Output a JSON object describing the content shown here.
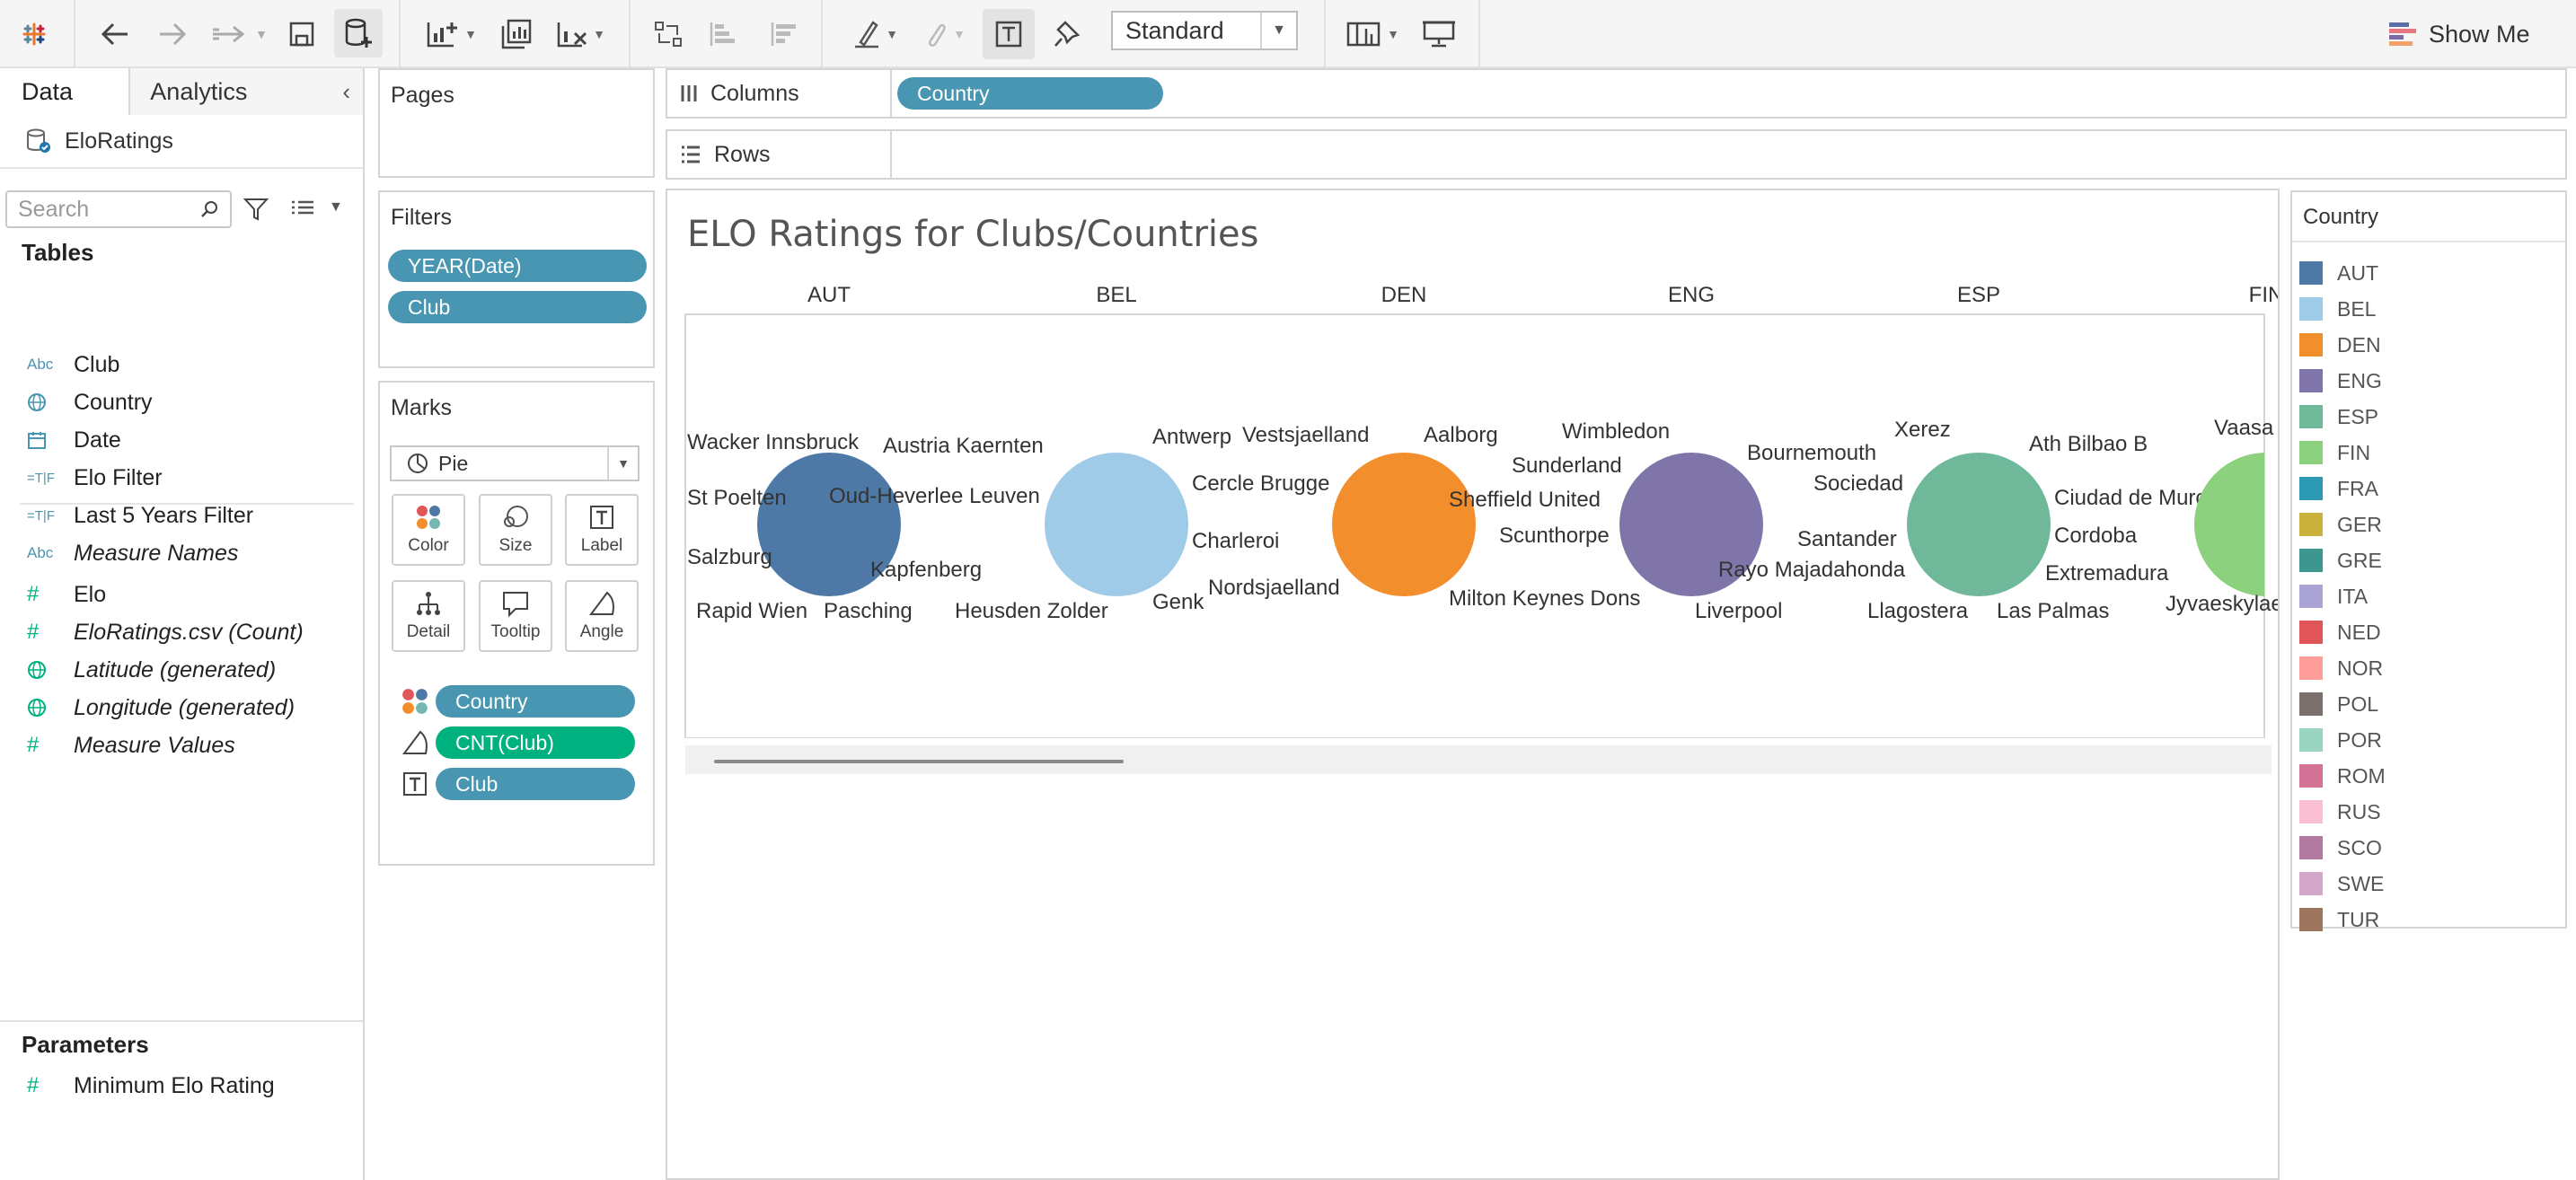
{
  "toolbar": {
    "mark_type_select": "Standard",
    "show_me": "Show Me"
  },
  "data_pane": {
    "tabs": [
      "Data",
      "Analytics"
    ],
    "datasource": "EloRatings",
    "search_placeholder": "Search",
    "tables_title": "Tables",
    "fields": [
      {
        "icon": "Abc",
        "name": "Club",
        "italic": false,
        "color": "#4996b2"
      },
      {
        "icon": "globe",
        "name": "Country",
        "italic": false,
        "color": "#4996b2"
      },
      {
        "icon": "calendar",
        "name": "Date",
        "italic": false,
        "color": "#4996b2"
      },
      {
        "icon": "=T|F",
        "name": "Elo Filter",
        "italic": false,
        "color": "#4996b2"
      },
      {
        "icon": "=T|F",
        "name": "Last 5 Years Filter",
        "italic": false,
        "color": "#4996b2"
      },
      {
        "icon": "Abc",
        "name": "Measure Names",
        "italic": true,
        "color": "#4996b2"
      },
      {
        "icon": "#",
        "name": "Elo",
        "italic": false,
        "color": "#00b180"
      },
      {
        "icon": "#",
        "name": "EloRatings.csv (Count)",
        "italic": true,
        "color": "#00b180"
      },
      {
        "icon": "globe",
        "name": "Latitude (generated)",
        "italic": true,
        "color": "#00b180"
      },
      {
        "icon": "globe",
        "name": "Longitude (generated)",
        "italic": true,
        "color": "#00b180"
      },
      {
        "icon": "#",
        "name": "Measure Values",
        "italic": true,
        "color": "#00b180"
      }
    ],
    "parameters_title": "Parameters",
    "parameters": [
      {
        "icon": "#",
        "name": "Minimum Elo Rating"
      }
    ]
  },
  "pages": {
    "title": "Pages"
  },
  "filters": {
    "title": "Filters",
    "pills": [
      "YEAR(Date)",
      "Club"
    ]
  },
  "marks": {
    "title": "Marks",
    "mark_type": "Pie",
    "buttons": [
      "Color",
      "Size",
      "Label",
      "Detail",
      "Tooltip",
      "Angle"
    ],
    "encodings": [
      {
        "icon": "color",
        "label": "Country",
        "kind": "dimension"
      },
      {
        "icon": "angle",
        "label": "CNT(Club)",
        "kind": "measure"
      },
      {
        "icon": "label",
        "label": "Club",
        "kind": "dimension"
      }
    ]
  },
  "columns_shelf": {
    "label": "Columns",
    "pills": [
      "Country"
    ]
  },
  "rows_shelf": {
    "label": "Rows",
    "pills": []
  },
  "view": {
    "title": "ELO Ratings for Clubs/Countries",
    "columns": [
      "AUT",
      "BEL",
      "DEN",
      "ENG",
      "ESP",
      "FIN"
    ]
  },
  "chart_data": {
    "type": "pie",
    "title": "ELO Ratings for Clubs/Countries",
    "categories": [
      "AUT",
      "BEL",
      "DEN",
      "ENG",
      "ESP",
      "FIN"
    ],
    "pies": [
      {
        "country": "AUT",
        "color": "#4e79a7",
        "labels": [
          "Wacker Innsbruck",
          "Austria Kaernten",
          "St Poelten",
          "Oud-Heverlee Leuven",
          "Salzburg",
          "Kapfenberg",
          "Rapid Wien",
          "Pasching"
        ]
      },
      {
        "country": "BEL",
        "color": "#a0cbe8",
        "labels": [
          "Antwerp",
          "Cercle Brugge",
          "Charleroi",
          "Genk",
          "Heusden Zolder"
        ]
      },
      {
        "country": "DEN",
        "color": "#f28e2b",
        "labels": [
          "Vestsjaelland",
          "Aalborg",
          "Nordsjaelland"
        ]
      },
      {
        "country": "ENG",
        "color": "#8075a8",
        "labels": [
          "Wimbledon",
          "Sunderland",
          "Sheffield United",
          "Scunthorpe",
          "Milton Keynes Dons",
          "Bournemouth",
          "Liverpool"
        ]
      },
      {
        "country": "ESP",
        "color": "#6fb899",
        "labels": [
          "Xerez",
          "Sociedad",
          "Santander",
          "Rayo Majadahonda",
          "Llagostera",
          "Ath Bilbao B",
          "Ciudad de Murcia",
          "Cordoba",
          "Extremadura",
          "Las Palmas"
        ]
      },
      {
        "country": "FIN",
        "color": "#8cd17d",
        "labels": [
          "Vaasa",
          "Jyvaeskylae"
        ]
      }
    ]
  },
  "legend": {
    "title": "Country",
    "items": [
      {
        "label": "AUT",
        "color": "#4e79a7"
      },
      {
        "label": "BEL",
        "color": "#a0cbe8"
      },
      {
        "label": "DEN",
        "color": "#f28e2b"
      },
      {
        "label": "ENG",
        "color": "#8075a8"
      },
      {
        "label": "ESP",
        "color": "#6fb899"
      },
      {
        "label": "FIN",
        "color": "#8cd17d"
      },
      {
        "label": "FRA",
        "color": "#2b9bb3"
      },
      {
        "label": "GER",
        "color": "#c9b23b"
      },
      {
        "label": "GRE",
        "color": "#3e9690"
      },
      {
        "label": "ITA",
        "color": "#a9a4d4"
      },
      {
        "label": "NED",
        "color": "#e15759"
      },
      {
        "label": "NOR",
        "color": "#ff9d9a"
      },
      {
        "label": "POL",
        "color": "#79706e"
      },
      {
        "label": "POR",
        "color": "#98d4c0"
      },
      {
        "label": "ROM",
        "color": "#d37295"
      },
      {
        "label": "RUS",
        "color": "#fabfd2"
      },
      {
        "label": "SCO",
        "color": "#b07aa1"
      },
      {
        "label": "SWE",
        "color": "#d4a6c8"
      },
      {
        "label": "TUR",
        "color": "#9d7660"
      }
    ]
  }
}
